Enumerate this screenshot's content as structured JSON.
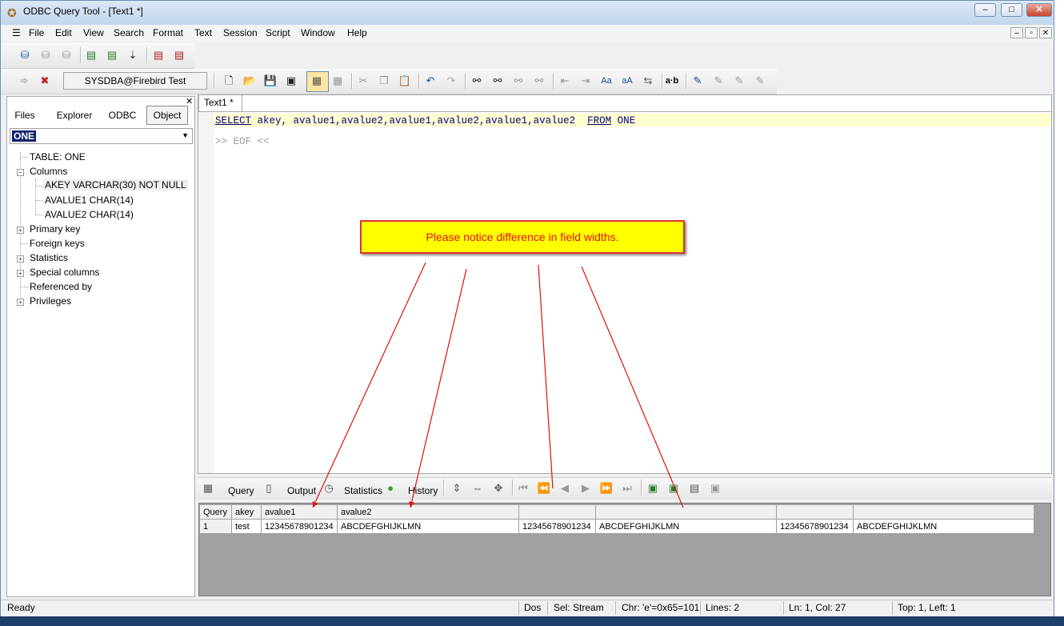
{
  "window": {
    "title": "ODBC Query Tool - [Text1 *]",
    "minimize": "–",
    "maximize": "□",
    "close": "✕"
  },
  "menu": [
    "File",
    "Edit",
    "View",
    "Search",
    "Format",
    "Text",
    "Session",
    "Script",
    "Window",
    "Help"
  ],
  "connection": "SYSDBA@Firebird Test",
  "left_tabs": [
    "Files",
    "Explorer",
    "ODBC",
    "Object"
  ],
  "object_select": "ONE",
  "tree": {
    "table": "TABLE: ONE",
    "columns": "Columns",
    "col_items": [
      "AKEY VARCHAR(30) NOT NULL",
      "AVALUE1 CHAR(14)",
      "AVALUE2 CHAR(14)"
    ],
    "primary_key": "Primary key",
    "foreign_keys": "Foreign keys",
    "statistics": "Statistics",
    "special_columns": "Special columns",
    "referenced_by": "Referenced by",
    "privileges": "Privileges"
  },
  "editor": {
    "tab": "Text1 *",
    "sql_kw1": "SELECT",
    "sql_mid": " akey, avalue1,avalue2,avalue1,avalue2,avalue1,avalue2  ",
    "sql_kw2": "FROM",
    "sql_tail": " ONE",
    "eof": ">> EOF <<"
  },
  "annotation": "Please notice difference in field widths.",
  "result_tabs": [
    "Query",
    "Output",
    "Statistics",
    "History"
  ],
  "grid": {
    "headers": [
      "Query",
      "akey",
      "avalue1",
      "avalue2",
      "",
      "",
      "",
      ""
    ],
    "row": [
      "1",
      "test",
      "12345678901234",
      "ABCDEFGHIJKLMN",
      "12345678901234",
      "ABCDEFGHIJKLMN",
      "12345678901234",
      "ABCDEFGHIJKLMN"
    ]
  },
  "status": {
    "ready": "Ready",
    "mode": "Dos",
    "sel": "Sel: Stream",
    "chr": "Chr: 'e'=0x65=101",
    "lines": "Lines: 2",
    "pos": "Ln: 1, Col: 27",
    "top": "Top: 1, Left: 1"
  },
  "colors": {
    "accent": "#0a246a",
    "annotation_border": "#e03030",
    "annotation_fill": "#ffff00",
    "current_line": "#ffffd0"
  }
}
